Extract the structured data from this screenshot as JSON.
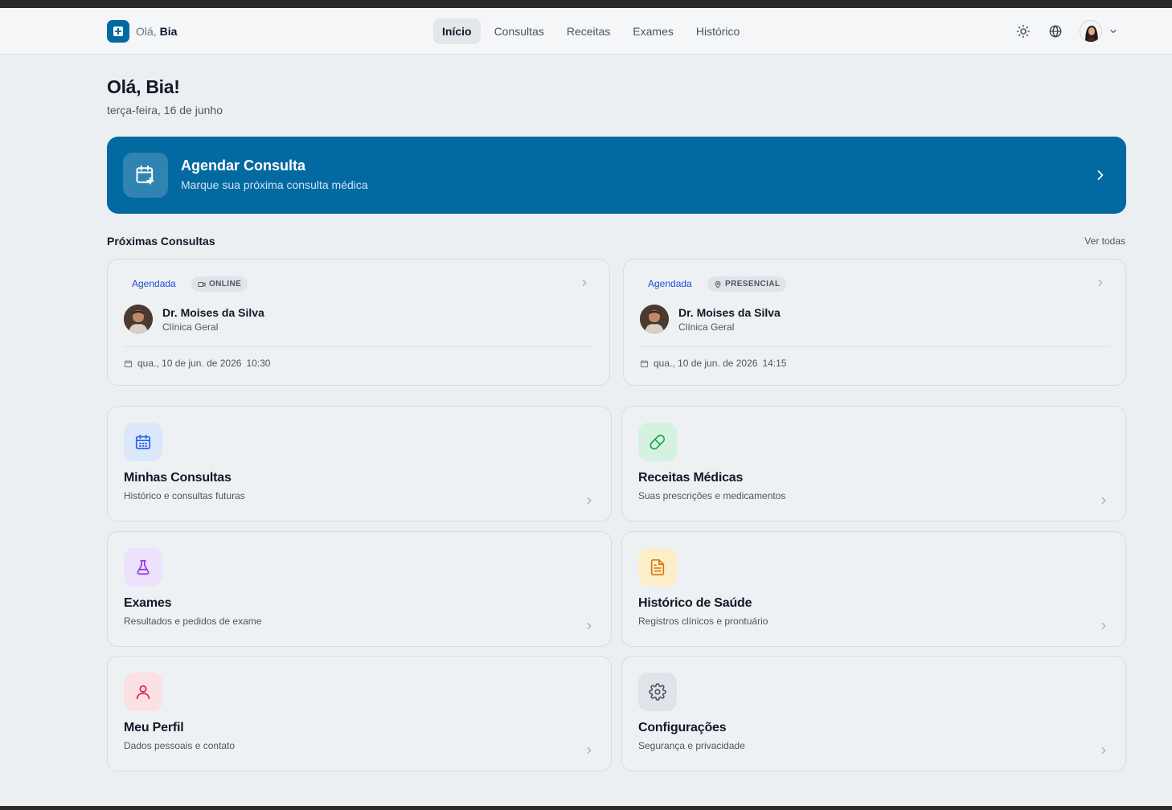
{
  "header": {
    "greeting_prefix": "Olá,",
    "greeting_name": "Bia",
    "nav": [
      {
        "label": "Início",
        "active": true
      },
      {
        "label": "Consultas",
        "active": false
      },
      {
        "label": "Receitas",
        "active": false
      },
      {
        "label": "Exames",
        "active": false
      },
      {
        "label": "Histórico",
        "active": false
      }
    ],
    "icons": [
      "sun-icon",
      "globe-icon",
      "chevron-down-icon"
    ]
  },
  "greeting": {
    "title": "Olá, Bia!",
    "date": "terça-feira, 16 de junho"
  },
  "cta": {
    "title": "Agendar Consulta",
    "subtitle": "Marque sua próxima consulta médica",
    "icon": "calendar-plus-icon"
  },
  "upcoming": {
    "title": "Próximas Consultas",
    "view_all": "Ver todas",
    "items": [
      {
        "status": "Agendada",
        "type": "ONLINE",
        "type_icon": "video-icon",
        "doctor": "Dr. Moises da Silva",
        "specialty": "Clínica Geral",
        "date": "qua., 10 de jun. de 2026",
        "time": "10:30"
      },
      {
        "status": "Agendada",
        "type": "PRESENCIAL",
        "type_icon": "map-pin-icon",
        "doctor": "Dr. Moises da Silva",
        "specialty": "Clínica Geral",
        "date": "qua., 10 de jun. de 2026",
        "time": "14:15"
      }
    ]
  },
  "features": [
    {
      "title": "Minhas Consultas",
      "subtitle": "Histórico e consultas futuras",
      "icon": "calendar-icon",
      "color": "#2563eb",
      "bg": "#dbe8fb"
    },
    {
      "title": "Receitas Médicas",
      "subtitle": "Suas prescrições e medicamentos",
      "icon": "pill-icon",
      "color": "#16a34a",
      "bg": "#d5f2e0"
    },
    {
      "title": "Exames",
      "subtitle": "Resultados e pedidos de exame",
      "icon": "flask-icon",
      "color": "#9333ea",
      "bg": "#ece2fb"
    },
    {
      "title": "Histórico de Saúde",
      "subtitle": "Registros clínicos e prontuário",
      "icon": "file-text-icon",
      "color": "#d97706",
      "bg": "#fbeec9"
    },
    {
      "title": "Meu Perfil",
      "subtitle": "Dados pessoais e contato",
      "icon": "user-icon",
      "color": "#e11d48",
      "bg": "#fbe0e4"
    },
    {
      "title": "Configurações",
      "subtitle": "Segurança e privacidade",
      "icon": "gear-icon",
      "color": "#4b5563",
      "bg": "#e0e4e9"
    }
  ]
}
